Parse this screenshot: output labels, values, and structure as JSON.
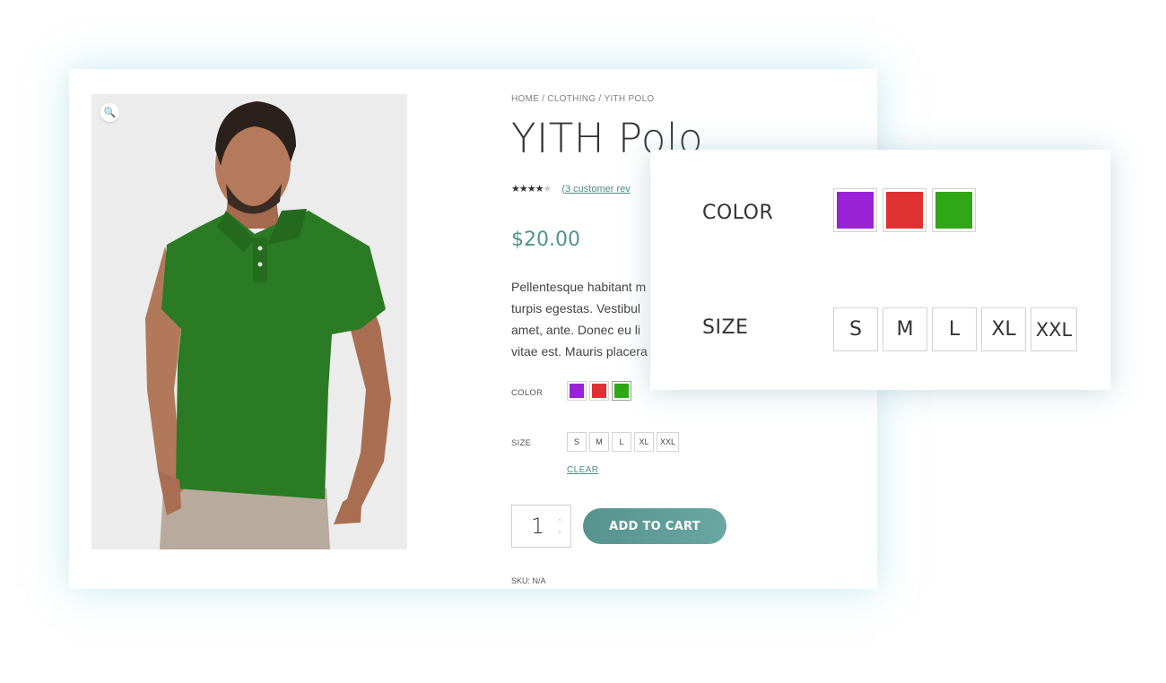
{
  "breadcrumb": {
    "home": "HOME",
    "category": "CLOTHING",
    "current": "YITH POLO",
    "separator": "/"
  },
  "product": {
    "title": "YITH Polo",
    "rating": 4.5,
    "stars_filled": "★★★★",
    "stars_half": "★",
    "review_link": "(3 customer rev",
    "price": "$20.00",
    "description_lines": [
      "Pellentesque habitant m",
      "turpis egestas. Vestibul",
      "amet, ante. Donec eu li",
      "vitae est. Mauris placera"
    ],
    "sku": "SKU: N/A"
  },
  "variations": {
    "color_label": "COLOR",
    "colors": [
      {
        "name": "purple",
        "hex": "#9a22d6"
      },
      {
        "name": "red",
        "hex": "#df3131"
      },
      {
        "name": "green",
        "hex": "#30a716"
      }
    ],
    "selected_color": "green",
    "size_label": "SIZE",
    "sizes": [
      "S",
      "M",
      "L",
      "XL",
      "XXL"
    ],
    "clear_label": "CLEAR"
  },
  "cart": {
    "quantity": "1",
    "add_to_cart_label": "ADD TO CART",
    "step_up": "⌃",
    "step_down": "⌄"
  },
  "icons": {
    "zoom": "🔍"
  },
  "colors": {
    "accent": "#4f948d",
    "button": "#5f9d98",
    "shirt": "#2b7a24"
  },
  "popup": {
    "color_label": "COLOR",
    "size_label": "SIZE",
    "sizes": [
      "S",
      "M",
      "L",
      "XL",
      "XXL"
    ]
  }
}
